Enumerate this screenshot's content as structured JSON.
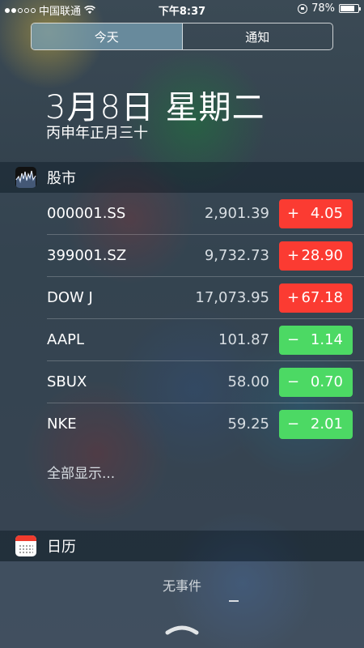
{
  "status_bar": {
    "carrier": "中国联通",
    "time": "下午8:37",
    "battery": "78%",
    "battery_level": 0.78,
    "signal_bars_filled": 2,
    "signal_bars_total": 5
  },
  "segmented_control": {
    "tabs": [
      {
        "label": "今天",
        "active": true
      },
      {
        "label": "通知",
        "active": false
      }
    ]
  },
  "date": {
    "title": "3月8日 星期二",
    "lunar": "丙申年正月三十"
  },
  "stocks_widget": {
    "title": "股市",
    "icon": "stocks-icon",
    "rows": [
      {
        "symbol": "000001.SS",
        "price": "2,901.39",
        "sign": "+",
        "change": "4.05",
        "direction": "up"
      },
      {
        "symbol": "399001.SZ",
        "price": "9,732.73",
        "sign": "+",
        "change": "28.90",
        "direction": "up"
      },
      {
        "symbol": "DOW J",
        "price": "17,073.95",
        "sign": "+",
        "change": "67.18",
        "direction": "up"
      },
      {
        "symbol": "AAPL",
        "price": "101.87",
        "sign": "−",
        "change": "1.14",
        "direction": "down"
      },
      {
        "symbol": "SBUX",
        "price": "58.00",
        "sign": "−",
        "change": "0.70",
        "direction": "down"
      },
      {
        "symbol": "NKE",
        "price": "59.25",
        "sign": "−",
        "change": "2.01",
        "direction": "down"
      }
    ],
    "show_all": "全部显示..."
  },
  "calendar_widget": {
    "title": "日历",
    "icon": "calendar-icon",
    "empty_text": "无事件"
  },
  "colors": {
    "up": "#fb3b32",
    "down": "#4cd964"
  },
  "pull_handle_icon": "chevron-up-icon"
}
